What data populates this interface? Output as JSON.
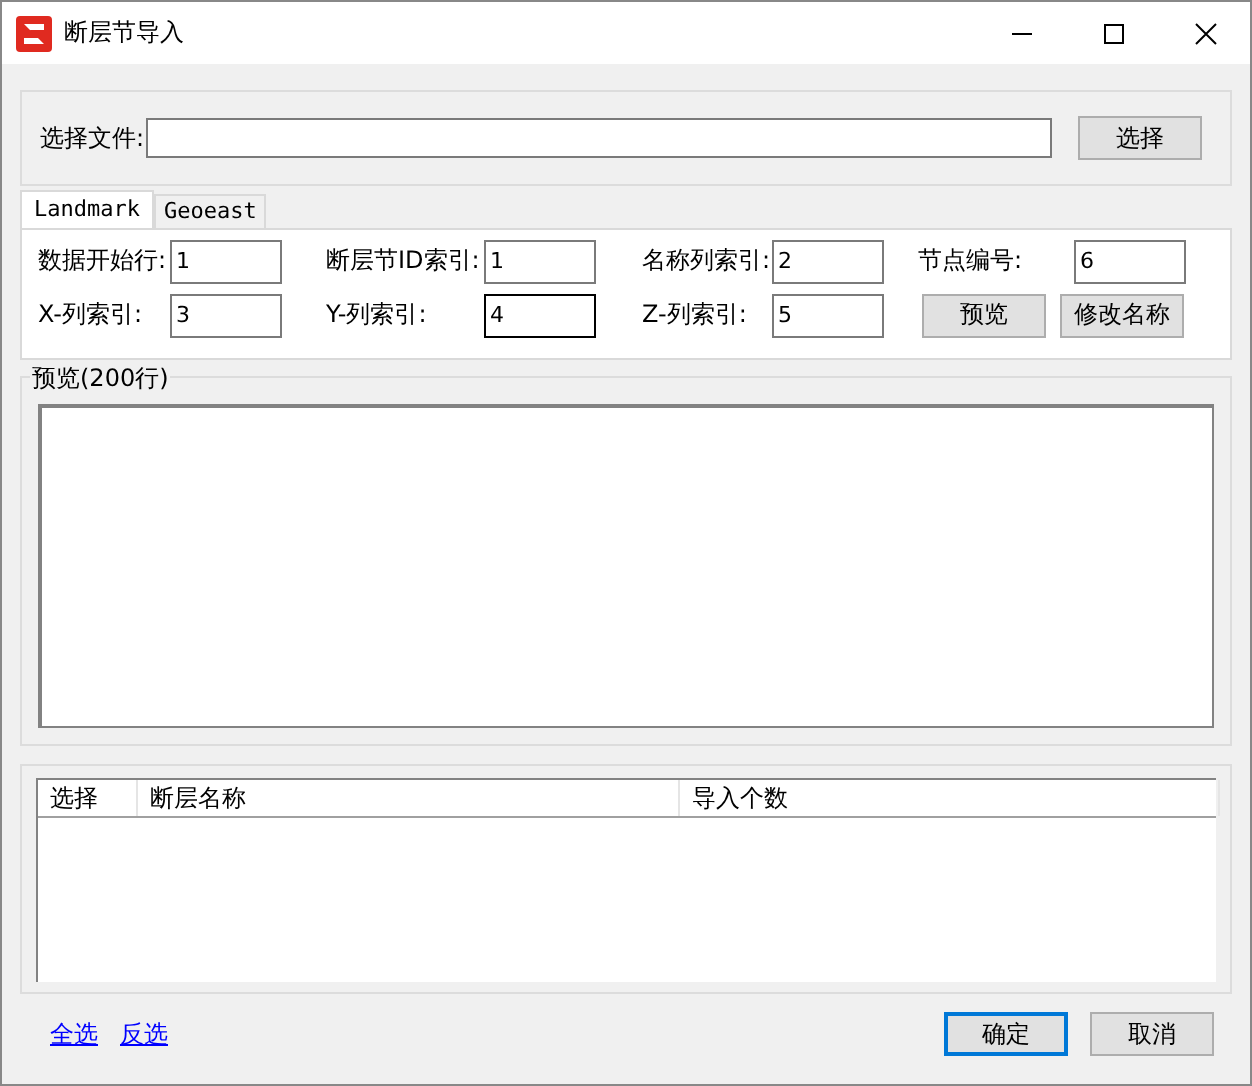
{
  "window": {
    "title": "断层节导入"
  },
  "file": {
    "label": "选择文件:",
    "button": "选择"
  },
  "tabs": [
    {
      "label": "Landmark",
      "selected": true
    },
    {
      "label": "Geoeast",
      "selected": false
    }
  ],
  "fields": [
    {
      "label": "数据开始行:",
      "value": "1",
      "focused": false
    },
    {
      "label": "断层节ID索引:",
      "value": "1",
      "focused": false
    },
    {
      "label": "名称列索引:",
      "value": "2",
      "focused": false
    },
    {
      "label": "节点编号:",
      "value": "6",
      "focused": false
    },
    {
      "label": "X-列索引:",
      "value": "3",
      "focused": false
    },
    {
      "label": "Y-列索引:",
      "value": "4",
      "focused": true
    },
    {
      "label": "Z-列索引:",
      "value": "5",
      "focused": false
    }
  ],
  "tab_buttons": [
    "预览",
    "修改名称"
  ],
  "preview": {
    "title": "预览(200行)"
  },
  "table": {
    "columns": [
      "选择",
      "断层名称",
      "导入个数"
    ]
  },
  "links": [
    "全选",
    "反选"
  ],
  "buttons": [
    {
      "label": "确定",
      "default": true
    },
    {
      "label": "取消",
      "default": false
    }
  ]
}
